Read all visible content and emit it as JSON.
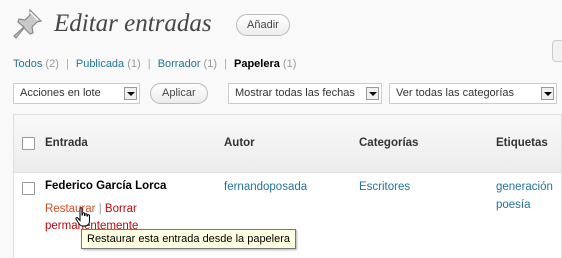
{
  "header": {
    "title": "Editar entradas",
    "add_new_label": "Añadir"
  },
  "filters": {
    "all": {
      "label": "Todos",
      "count": "(2)"
    },
    "published": {
      "label": "Publicada",
      "count": "(1)"
    },
    "draft": {
      "label": "Borrador",
      "count": "(1)"
    },
    "trash": {
      "label": "Papelera",
      "count": "(1)"
    },
    "separator": "|"
  },
  "bulk": {
    "actions_label": "Acciones en lote",
    "apply_label": "Aplicar",
    "dates_label": "Mostrar todas las fechas",
    "categories_label": "Ver todas las categorías"
  },
  "table": {
    "columns": [
      "Entrada",
      "Autor",
      "Categorías",
      "Etiquetas"
    ],
    "rows": [
      {
        "title": "Federico García Lorca",
        "restore_label": "Restaurar",
        "separator": "|",
        "delete_label": "Borrar permanentemente",
        "author": "fernandoposada",
        "category": "Escritores",
        "tags": [
          "generación",
          "poesía"
        ]
      }
    ]
  },
  "tooltip": {
    "text": "Restaurar esta entrada desde la papelera"
  },
  "colors": {
    "link": "#21759b",
    "restore": "#d54e21",
    "delete": "#bc0b0b",
    "tooltip_bg": "#ffffe1"
  }
}
